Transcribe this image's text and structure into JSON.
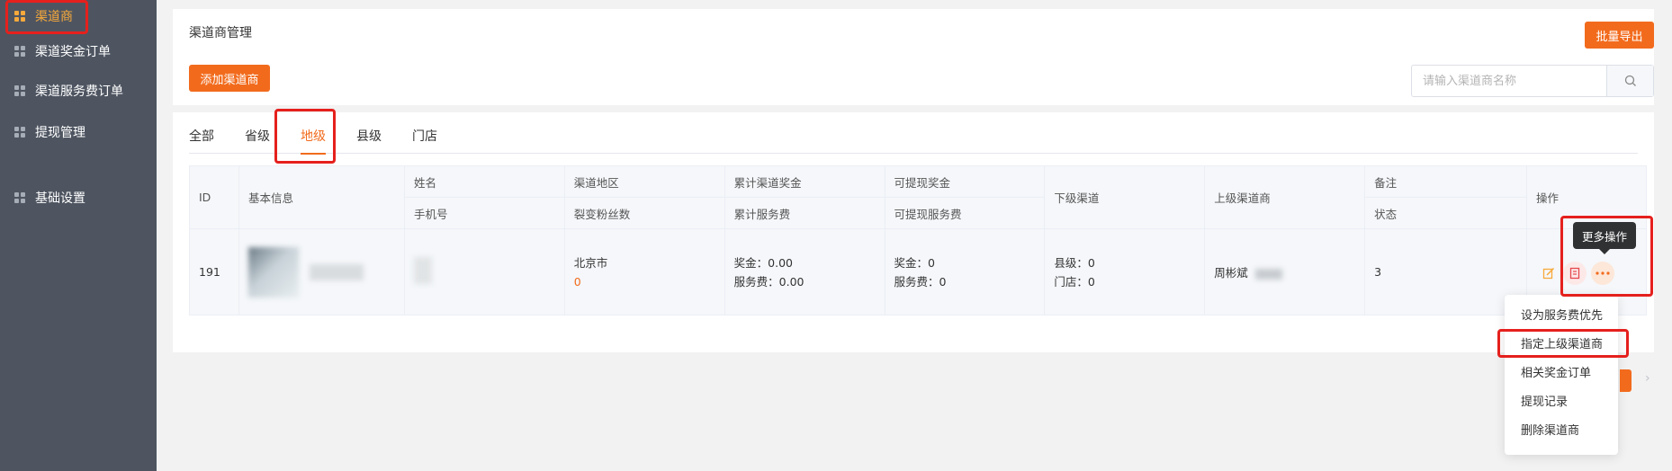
{
  "sidebar": {
    "items": [
      {
        "label": "渠道商",
        "icon": "grid-icon",
        "active": true
      },
      {
        "label": "渠道奖金订单",
        "icon": "grid-icon",
        "active": false
      },
      {
        "label": "渠道服务费订单",
        "icon": "grid-icon",
        "active": false
      },
      {
        "label": "提现管理",
        "icon": "grid-icon",
        "active": false
      },
      {
        "label": "基础设置",
        "icon": "grid-icon",
        "active": false
      }
    ]
  },
  "header": {
    "title": "渠道商管理",
    "export_label": "批量导出",
    "add_label": "添加渠道商",
    "search_placeholder": "请输入渠道商名称"
  },
  "tabs": [
    "全部",
    "省级",
    "地级",
    "县级",
    "门店"
  ],
  "active_tab": "地级",
  "table": {
    "headers": {
      "id": "ID",
      "basic": "基本信息",
      "name": "姓名",
      "phone": "手机号",
      "region": "渠道地区",
      "fans": "裂变粉丝数",
      "bonus_total": "累计渠道奖金",
      "service_total": "累计服务费",
      "bonus_withdraw": "可提现奖金",
      "service_withdraw": "可提现服务费",
      "sub_channel": "下级渠道",
      "parent": "上级渠道商",
      "remark": "备注",
      "status": "状态",
      "actions": "操作"
    },
    "rows": [
      {
        "id": "191",
        "region": "北京市",
        "fans": "0",
        "bonus_total": "奖金：0.00",
        "service_total": "服务费：0.00",
        "bonus_withdraw": "奖金：0",
        "service_withdraw": "服务费：0",
        "sub_county": "县级：0",
        "sub_store": "门店：0",
        "parent": "周彬斌",
        "remark": "3"
      }
    ]
  },
  "tooltip": "更多操作",
  "dropdown": {
    "items": [
      "设为服务费优先",
      "指定上级渠道商",
      "相关奖金订单",
      "提现记录",
      "删除渠道商"
    ]
  },
  "colors": {
    "accent": "#f26b1d",
    "sidebar_bg": "#4e5561",
    "sidebar_active": "#f7a93b",
    "highlight": "#e5201d"
  }
}
